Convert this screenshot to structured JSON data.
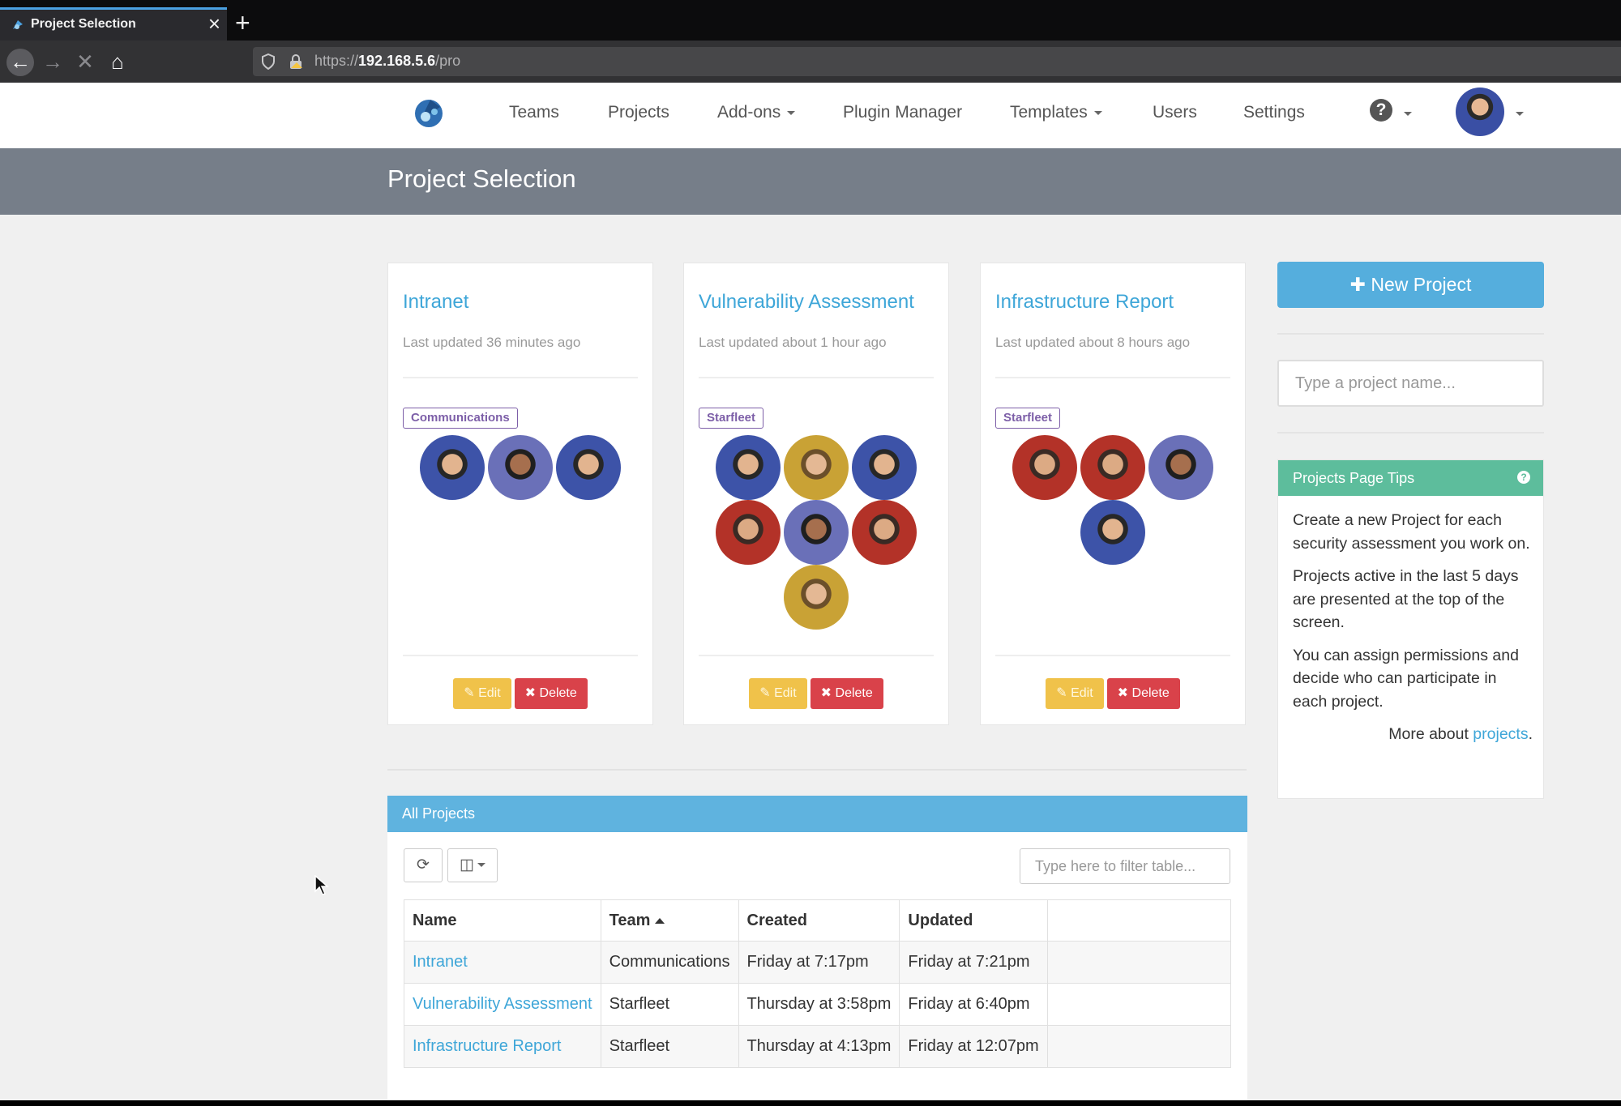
{
  "browser": {
    "tab_title": "Project Selection",
    "url_host": "192.168.5.6",
    "url_prefix": "https://",
    "url_path": "/pro"
  },
  "nav": {
    "items": [
      {
        "label": "Teams"
      },
      {
        "label": "Projects"
      },
      {
        "label": "Add-ons",
        "dropdown": true
      },
      {
        "label": "Plugin Manager"
      },
      {
        "label": "Templates",
        "dropdown": true
      },
      {
        "label": "Users"
      },
      {
        "label": "Settings"
      }
    ],
    "help_glyph": "?"
  },
  "page": {
    "title": "Project Selection"
  },
  "cards": [
    {
      "title": "Intranet",
      "updated": "Last updated 36 minutes ago",
      "team": "Communications",
      "edit_label": "Edit",
      "delete_label": "Delete"
    },
    {
      "title": "Vulnerability Assessment",
      "updated": "Last updated about 1 hour ago",
      "team": "Starfleet",
      "edit_label": "Edit",
      "delete_label": "Delete"
    },
    {
      "title": "Infrastructure Report",
      "updated": "Last updated about 8 hours ago",
      "team": "Starfleet",
      "edit_label": "Edit",
      "delete_label": "Delete"
    }
  ],
  "sidebar": {
    "new_project_label": "New Project",
    "search_placeholder": "Type a project name...",
    "tips_title": "Projects Page Tips",
    "tips": [
      "Create a new Project for each security assessment you work on.",
      "Projects active in the last 5 days are presented at the top of the screen.",
      "You can assign permissions and decide who can participate in each project."
    ],
    "more_prefix": "More about ",
    "more_link": "projects",
    "more_suffix": "."
  },
  "all_projects": {
    "title": "All Projects",
    "filter_placeholder": "Type here to filter table...",
    "columns": [
      "Name",
      "Team",
      "Created",
      "Updated"
    ],
    "rows": [
      {
        "name": "Intranet",
        "team": "Communications",
        "created": "Friday at 7:17pm",
        "updated": "Friday at 7:21pm"
      },
      {
        "name": "Vulnerability Assessment",
        "team": "Starfleet",
        "created": "Thursday at 3:58pm",
        "updated": "Friday at 6:40pm"
      },
      {
        "name": "Infrastructure Report",
        "team": "Starfleet",
        "created": "Thursday at 4:13pm",
        "updated": "Friday at 12:07pm"
      }
    ]
  },
  "colors": {
    "accent": "#3ea6d8",
    "header_band": "#767e89",
    "tips_header": "#5dbd9c",
    "edit": "#f0c24a",
    "delete": "#d9424a",
    "badge": "#7d5fa8"
  }
}
